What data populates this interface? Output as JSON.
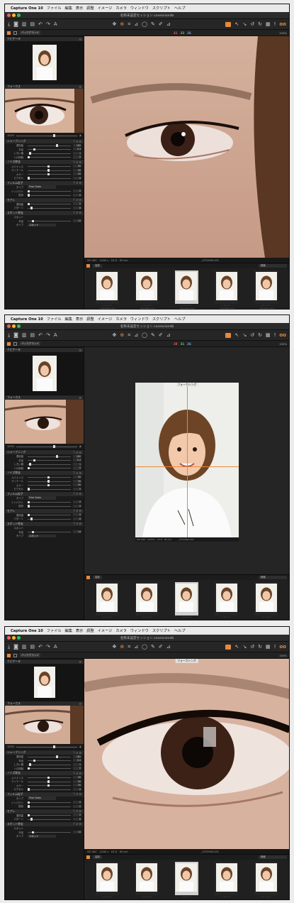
{
  "menu": {
    "app": "Capture One 10",
    "items": [
      "ファイル",
      "編集",
      "表示",
      "調整",
      "イメージ",
      "カメラ",
      "ウィンドウ",
      "スクリプト",
      "ヘルプ"
    ]
  },
  "window_title": "名称未設定セッション.cosessiondb",
  "toolbar": {
    "left_icons": [
      "import-icon",
      "camera-icon",
      "delete-icon",
      "folder-icon",
      "undo-icon",
      "redo-icon",
      "text-icon"
    ],
    "center_icons": [
      "pan-icon",
      "loupe-icon",
      "crop-icon",
      "keystone-icon",
      "spot-icon",
      "brush-icon",
      "eraser-icon",
      "picker-icon"
    ],
    "right_icons": [
      "edit-all-icon",
      "copy-icon",
      "apply-icon",
      "reset-icon",
      "rotate-icon",
      "proof-icon",
      "exposure-icon",
      "glasses-icon"
    ],
    "accent": "#e8893a"
  },
  "subbar": {
    "layer_label": "バックグランド",
    "counts": {
      "r": "41",
      "g": "33",
      "b": "26",
      "r2": "38",
      "g2": "31",
      "b2": "26"
    },
    "zoom": "100%"
  },
  "panel": {
    "navigator_title": "ナビゲータ",
    "focus_title": "フォーカス",
    "zoom_value": "100%",
    "sharpening": {
      "title": "シャープニング",
      "rows": [
        {
          "label": "適用量",
          "value": "182"
        },
        {
          "label": "半径",
          "value": "0.4"
        },
        {
          "label": "しきい値",
          "value": "1"
        },
        {
          "label": "ハロ抑制",
          "value": "0"
        }
      ]
    },
    "noise": {
      "title": "ノイズ除去",
      "rows": [
        {
          "label": "ルミナンス",
          "value": "50"
        },
        {
          "label": "ディテール",
          "value": "50"
        },
        {
          "label": "カラー",
          "value": "50"
        },
        {
          "label": "ピクセル",
          "value": "0"
        }
      ]
    },
    "grain": {
      "title": "フィルム粒子",
      "type_label": "タイプ",
      "type_value": "Fine Grain",
      "impact_label": "インパクト",
      "impact_value": "0",
      "granularity_label": "粒状",
      "granularity_value": "0"
    },
    "moire": {
      "title": "モアレ",
      "rows": [
        {
          "label": "適用量",
          "value": "0"
        },
        {
          "label": "パターン",
          "value": "8"
        }
      ]
    },
    "spot": {
      "title": "スポット除去",
      "rows": [
        {
          "label": "スポット",
          "value": ""
        },
        {
          "label": "半径",
          "value": "14"
        }
      ],
      "type_label": "タイプ",
      "type_value": "スポット"
    }
  },
  "meta": {
    "iso": "ISO 400",
    "shutter": "1/200 s",
    "aperture": "f/2.8",
    "focal": "85 mm",
    "filename": "_UTC0969.CR2"
  },
  "focus_overlay": "フォーカシング",
  "browser": {
    "sort_label": "名前",
    "search_placeholder": "検索",
    "thumb_caption": "_UTC0969.CR2",
    "selected_index": 2,
    "count": 5
  }
}
